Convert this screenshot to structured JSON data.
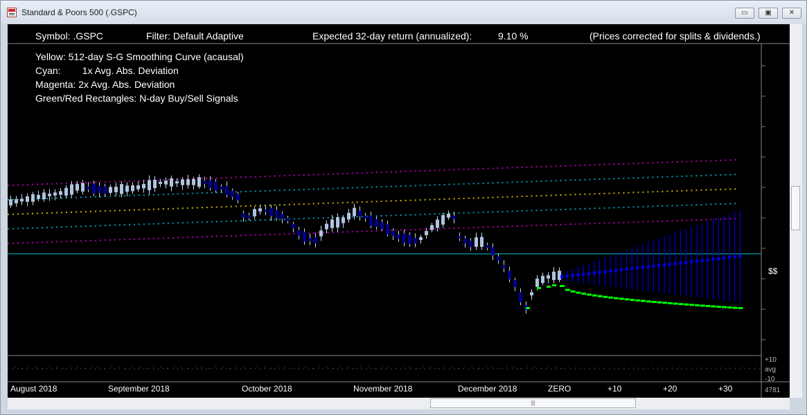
{
  "window": {
    "title": "Standard & Poors 500 (.GSPC)",
    "buttons": {
      "minimize": "▭",
      "restore": "▣",
      "close": "✕"
    }
  },
  "header": {
    "symbol": "Symbol: .GSPC",
    "filter": "Filter: Default Adaptive",
    "expected_return_label": "Expected 32-day return (annualized):",
    "expected_return_value": "9.10 %",
    "note": "(Prices corrected for splits & dividends.)"
  },
  "legend": {
    "yellow": "Yellow: 512-day S-G Smoothing Curve (acausal)",
    "cyan": "Cyan:        1x Avg. Abs. Deviation",
    "magenta": "Magenta: 2x Avg. Abs. Deviation",
    "rectangles": "Green/Red Rectangles: N-day Buy/Sell Signals"
  },
  "x_axis": {
    "months": [
      "August 2018",
      "September 2018",
      "October 2018",
      "November 2018",
      "December 2018"
    ],
    "forecast_ticks": [
      "ZERO",
      "+10",
      "+20",
      "+30"
    ]
  },
  "right_axis": {
    "price_label": "$$",
    "osc_top": "+10",
    "osc_mid": "avg",
    "osc_bottom": "-10",
    "last_value": "4781"
  },
  "colors": {
    "background": "#000000",
    "candle_up": "#b0c4de",
    "candle_down": "#00008b",
    "smoothing": "#c8b400",
    "deviation_1x": "#00a0b0",
    "deviation_2x": "#b000b0",
    "forecast": "#0000ff",
    "buy_signal": "#00ff00",
    "zero_line": "#00c8d0"
  },
  "chart_data": {
    "type": "candlestick",
    "title": "Standard & Poors 500 (.GSPC)",
    "x_labels": [
      "August 2018",
      "September 2018",
      "October 2018",
      "November 2018",
      "December 2018",
      "ZERO",
      "+10",
      "+20",
      "+30"
    ],
    "series": [
      {
        "name": "Yellow: 512-day S-G Smoothing Curve (acausal)",
        "style": "dotted",
        "color": "#c8b400"
      },
      {
        "name": "Cyan: 1x Avg. Abs. Deviation",
        "style": "dotted",
        "color": "#00a0b0"
      },
      {
        "name": "Magenta: 2x Avg. Abs. Deviation",
        "style": "dotted",
        "color": "#b000b0"
      },
      {
        "name": "Green/Red Rectangles: N-day Buy/Sell Signals",
        "color": "#00ff00"
      }
    ],
    "expected_return_annualized_pct": 9.1
  }
}
